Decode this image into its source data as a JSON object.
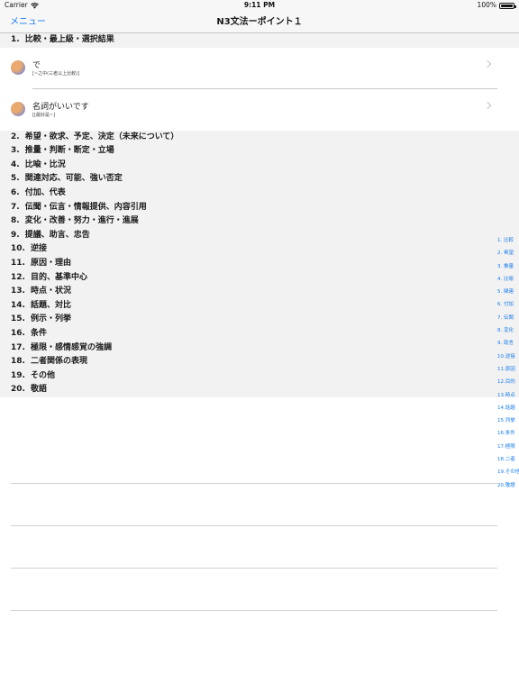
{
  "status": {
    "carrier": "Carrier",
    "time": "9:11 PM",
    "battery": "100%"
  },
  "nav": {
    "menu_label": "メニュー",
    "title": "N3文法ーポイント１"
  },
  "sections": [
    {
      "num": "1.",
      "title": "比較・最上級・選択結果",
      "rows": [
        {
          "title": "で",
          "sub": "[~之中(三者以上比較)]"
        },
        {
          "title": "名詞がいいです",
          "sub": "[[最好是~]"
        }
      ]
    },
    {
      "num": "2.",
      "title": "希望・欲求、予定、決定（未来について）"
    },
    {
      "num": "3.",
      "title": "推量・判断・断定・立場"
    },
    {
      "num": "4.",
      "title": "比喩・比況"
    },
    {
      "num": "5.",
      "title": "関連対応、可能、強い否定"
    },
    {
      "num": "6.",
      "title": "付加、代表"
    },
    {
      "num": "7.",
      "title": "伝聞・伝言・情報提供、内容引用"
    },
    {
      "num": "8.",
      "title": "変化・改善・努力・進行・進展"
    },
    {
      "num": "9.",
      "title": "提議、助言、忠告"
    },
    {
      "num": "10.",
      "title": "逆接"
    },
    {
      "num": "11.",
      "title": "原因・理由"
    },
    {
      "num": "12.",
      "title": "目的、基準中心"
    },
    {
      "num": "13.",
      "title": "時点・状況"
    },
    {
      "num": "14.",
      "title": "話題、対比"
    },
    {
      "num": "15.",
      "title": "例示・列挙"
    },
    {
      "num": "16.",
      "title": "条件"
    },
    {
      "num": "17.",
      "title": "極限・感情感覚の強調"
    },
    {
      "num": "18.",
      "title": "二者関係の表現"
    },
    {
      "num": "19.",
      "title": "その他"
    },
    {
      "num": "20.",
      "title": "敬語"
    }
  ],
  "index": [
    "1. 比較",
    "2. 希望",
    "3. 推量",
    "4. 比喩",
    "5. 関連",
    "6. 付加",
    "7. 伝聞",
    "8. 変化",
    "9. 助言",
    "10.逆接",
    "11.原因",
    "12.目的",
    "13.時点",
    "14.話題",
    "15.列挙",
    "16.条件",
    "17.極限",
    "18.二者",
    "19.その他",
    "20.敬語"
  ],
  "colors": {
    "accent": "#1a7cf0",
    "header_bg": "#f2f2f2",
    "nav_bg": "#f7f7f7"
  }
}
